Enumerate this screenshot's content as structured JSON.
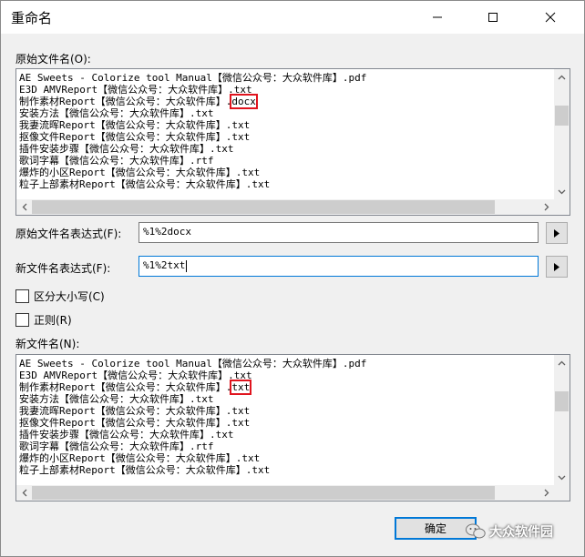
{
  "window": {
    "title": "重命名"
  },
  "original_names": {
    "label": "原始文件名(O):",
    "items": [
      {
        "text": "AE Sweets - Colorize tool Manual【微信公众号：大众软件库】.pdf"
      },
      {
        "text": "E3D AMVReport【微信公众号：大众软件库】.txt"
      },
      {
        "text": "制作素材Report【微信公众号：大众软件库】.",
        "highlight": "docx"
      },
      {
        "text": "安装方法【微信公众号：大众软件库】.txt"
      },
      {
        "text": "我妻流晖Report【微信公众号：大众软件库】.txt"
      },
      {
        "text": "抠像文件Report【微信公众号：大众软件库】.txt"
      },
      {
        "text": "插件安装步骤【微信公众号：大众软件库】.txt"
      },
      {
        "text": "歌词字幕【微信公众号：大众软件库】.rtf"
      },
      {
        "text": "爆炸的小区Report【微信公众号：大众软件库】.txt"
      },
      {
        "text": "粒子上部素材Report【微信公众号：大众软件库】.txt"
      }
    ]
  },
  "original_expr": {
    "label": "原始文件名表达式(F):",
    "value": "%1%2docx"
  },
  "new_expr": {
    "label": "新文件名表达式(F):",
    "value": "%1%2txt"
  },
  "options": {
    "case_label": "区分大小写(C)",
    "regex_label": "正则(R)"
  },
  "new_names": {
    "label": "新文件名(N):",
    "items": [
      {
        "text": "AE Sweets - Colorize tool Manual【微信公众号：大众软件库】.pdf"
      },
      {
        "text": "E3D AMVReport【微信公众号：大众软件库】.txt"
      },
      {
        "text": "制作素材Report【微信公众号：大众软件库】.",
        "highlight": "txt"
      },
      {
        "text": "安装方法【微信公众号：大众软件库】.txt"
      },
      {
        "text": "我妻流晖Report【微信公众号：大众软件库】.txt"
      },
      {
        "text": "抠像文件Report【微信公众号：大众软件库】.txt"
      },
      {
        "text": "插件安装步骤【微信公众号：大众软件库】.txt"
      },
      {
        "text": "歌词字幕【微信公众号：大众软件库】.rtf"
      },
      {
        "text": "爆炸的小区Report【微信公众号：大众软件库】.txt"
      },
      {
        "text": "粒子上部素材Report【微信公众号：大众软件库】.txt"
      }
    ]
  },
  "buttons": {
    "ok": "确定"
  },
  "watermark": {
    "text": "大众软件园",
    "icon": "wechat-icon"
  },
  "colors": {
    "accent": "#0078d7",
    "highlight_box": "#e0141e"
  }
}
